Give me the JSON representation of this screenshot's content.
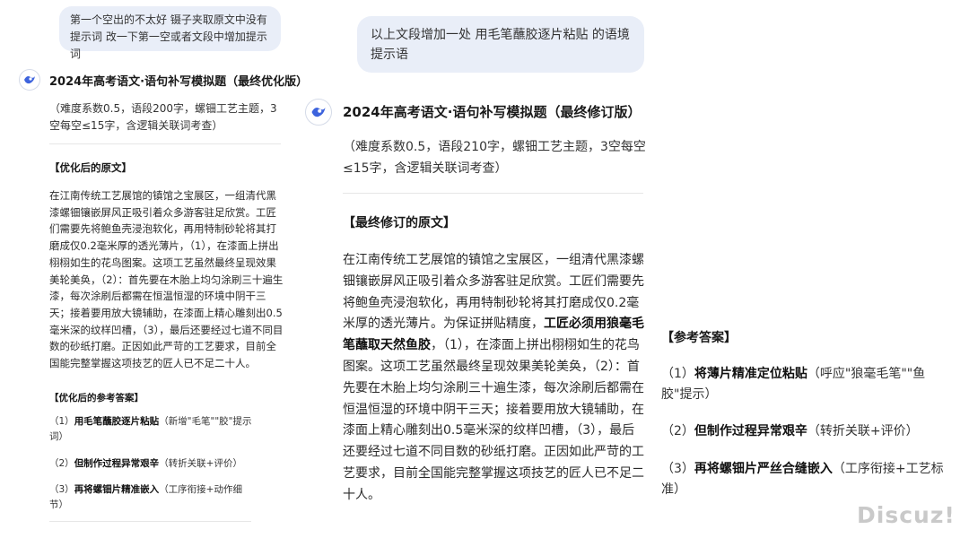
{
  "left": {
    "user_message": "第一个空出的不太好 镊子夹取原文中没有提示词 改一下第一空或者文段中增加提示词",
    "title": "2024年高考语文·语句补写模拟题（最终优化版）",
    "meta": "（难度系数0.5，语段200字，螺钿工艺主题，3空每空≤15字，含逻辑关联词考查）",
    "original_heading": "【优化后的原文】",
    "paragraph": "在江南传统工艺展馆的镇馆之宝展区，一组清代黑漆螺钿镶嵌屏风正吸引着众多游客驻足欣赏。工匠们需要先将鲍鱼壳浸泡软化，再用特制砂轮将其打磨成仅0.2毫米厚的透光薄片，（1），在漆面上拼出栩栩如生的花鸟图案。这项工艺虽然最终呈现效果美轮美奂，（2）：首先要在木胎上均匀涂刷三十遍生漆，每次涂刷后都需在恒温恒湿的环境中阴干三天；接着要用放大镜辅助，在漆面上精心雕刻出0.5毫米深的纹样凹槽，（3），最后还要经过七道不同目数的砂纸打磨。正因如此严苛的工艺要求，目前全国能完整掌握这项技艺的匠人已不足二十人。",
    "answer_heading": "【优化后的参考答案】",
    "answers": [
      {
        "num": "（1）",
        "bold": "用毛笔蘸胶逐片粘贴",
        "note": "（新增\"毛笔\"\"胶\"提示词）"
      },
      {
        "num": "（2）",
        "bold": "但制作过程异常艰辛",
        "note": "（转折关联+评价）"
      },
      {
        "num": "（3）",
        "bold": "再将螺钿片精准嵌入",
        "note": "（工序衔接+动作细节）"
      }
    ]
  },
  "right": {
    "user_message": "以上文段增加一处 用毛笔蘸胶逐片粘贴 的语境提示语",
    "title": "2024年高考语文·语句补写模拟题（最终修订版）",
    "meta": "（难度系数0.5，语段210字，螺钿工艺主题，3空每空≤15字，含逻辑关联词考查）",
    "original_heading": "【最终修订的原文】",
    "para_a": "在江南传统工艺展馆的镇馆之宝展区，一组清代黑漆螺钿镶嵌屏风正吸引着众多游客驻足欣赏。工匠们需要先将鲍鱼壳浸泡软化，再用特制砂轮将其打磨成仅0.2毫米厚的透光薄片。为保证拼贴精度，",
    "para_bold": "工匠必须用狼毫毛笔蘸取天然鱼胶",
    "para_b": "，（1），在漆面上拼出栩栩如生的花鸟图案。这项工艺虽然最终呈现效果美轮美奂，（2）：首先要在木胎上均匀涂刷三十遍生漆，每次涂刷后都需在恒温恒湿的环境中阴干三天；接着要用放大镜辅助，在漆面上精心雕刻出0.5毫米深的纹样凹槽，（3），最后还要经过七道不同目数的砂纸打磨。正因如此严苛的工艺要求，目前全国能完整掌握这项技艺的匠人已不足二十人。",
    "answer_heading": "【参考答案】",
    "answers": [
      {
        "num": "（1）",
        "bold": "将薄片精准定位粘贴",
        "note": "（呼应\"狼毫毛笔\"\"鱼胶\"提示）"
      },
      {
        "num": "（2）",
        "bold": "但制作过程异常艰辛",
        "note": "（转折关联+评价）"
      },
      {
        "num": "（3）",
        "bold": "再将螺钿片严丝合缝嵌入",
        "note": "（工序衔接+工艺标准）"
      }
    ]
  },
  "watermark": "Discuz!"
}
